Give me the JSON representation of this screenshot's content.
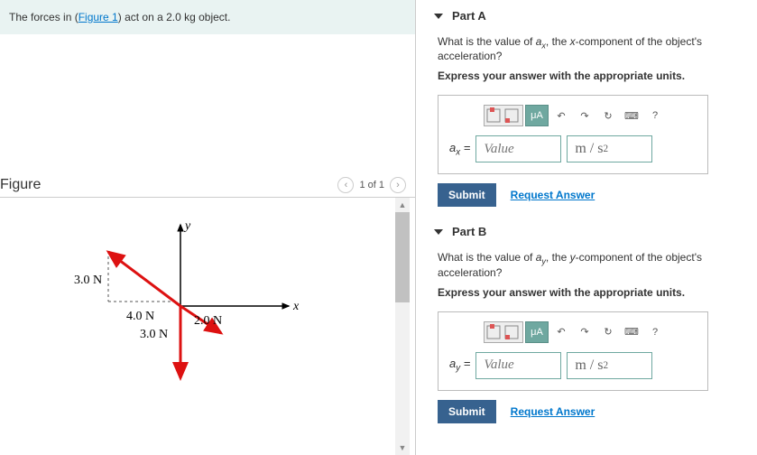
{
  "prompt": {
    "prefix": "The forces in (",
    "link": "Figure 1",
    "suffix": ") act on a 2.0 kg object."
  },
  "figure": {
    "title": "Figure",
    "pager": "1 of 1",
    "labels": {
      "y": "y",
      "x": "x",
      "f1": "3.0 N",
      "f2": "4.0 N",
      "f3": "2.0 N",
      "f4": "3.0 N"
    }
  },
  "parts": [
    {
      "title": "Part A",
      "question_pre": "What is the value of ",
      "question_var": "a",
      "question_sub": "x",
      "question_mid": ", the ",
      "question_comp": "x",
      "question_post": "-component of the object's acceleration?",
      "instruction": "Express your answer with the appropriate units.",
      "var_label_sub": "x",
      "value_placeholder": "Value",
      "unit_text": "m / s",
      "unit_sup": "2",
      "submit": "Submit",
      "request": "Request Answer",
      "mu": "μA",
      "help": "?"
    },
    {
      "title": "Part B",
      "question_pre": "What is the value of ",
      "question_var": "a",
      "question_sub": "y",
      "question_mid": ", the ",
      "question_comp": "y",
      "question_post": "-component of the object's acceleration?",
      "instruction": "Express your answer with the appropriate units.",
      "var_label_sub": "y",
      "value_placeholder": "Value",
      "unit_text": "m / s",
      "unit_sup": "2",
      "submit": "Submit",
      "request": "Request Answer",
      "mu": "μA",
      "help": "?"
    }
  ]
}
